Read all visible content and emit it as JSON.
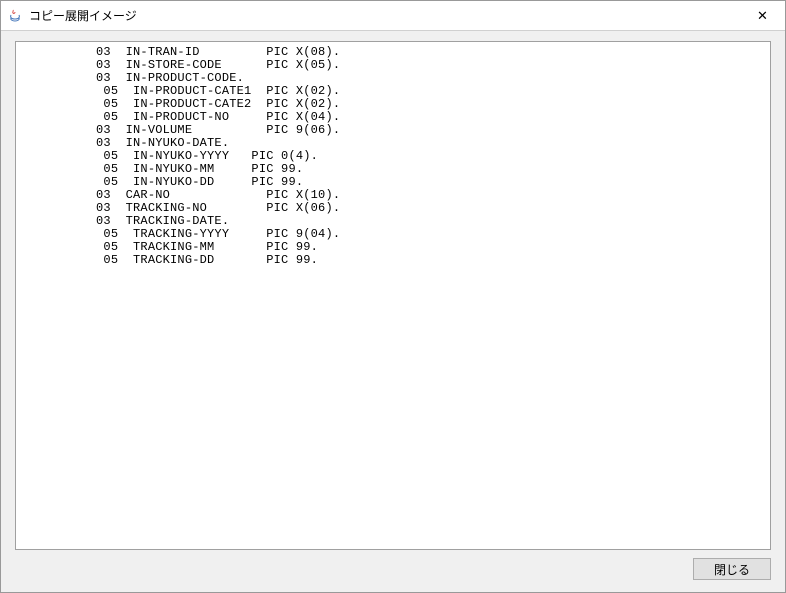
{
  "window": {
    "title": "コピー展開イメージ"
  },
  "code": {
    "lines": [
      "          03  IN-TRAN-ID         PIC X(08).",
      "          03  IN-STORE-CODE      PIC X(05).",
      "          03  IN-PRODUCT-CODE.",
      "           05  IN-PRODUCT-CATE1  PIC X(02).",
      "           05  IN-PRODUCT-CATE2  PIC X(02).",
      "           05  IN-PRODUCT-NO     PIC X(04).",
      "          03  IN-VOLUME          PIC 9(06).",
      "          03  IN-NYUKO-DATE.",
      "           05  IN-NYUKO-YYYY   PIC 0(4).",
      "           05  IN-NYUKO-MM     PIC 99.",
      "           05  IN-NYUKO-DD     PIC 99.",
      "          03  CAR-NO             PIC X(10).",
      "          03  TRACKING-NO        PIC X(06).",
      "          03  TRACKING-DATE.",
      "           05  TRACKING-YYYY     PIC 9(04).",
      "           05  TRACKING-MM       PIC 99.",
      "           05  TRACKING-DD       PIC 99."
    ]
  },
  "buttons": {
    "close_label": "閉じる"
  }
}
